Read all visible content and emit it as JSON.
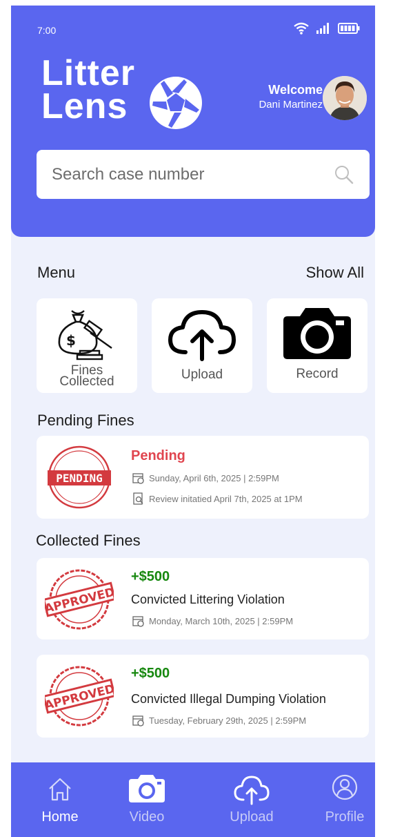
{
  "status_bar": {
    "time": "7:00"
  },
  "brand": {
    "line1": "Litter",
    "line2": "Lens"
  },
  "user": {
    "greeting": "Welcome",
    "name": "Dani Martinez"
  },
  "search": {
    "placeholder": "Search case number"
  },
  "menu": {
    "title": "Menu",
    "show_all": "Show All",
    "items": [
      {
        "label_line1": "Fines",
        "label_line2": "Collected",
        "icon": "money-bag-gavel-icon"
      },
      {
        "label": "Upload",
        "icon": "cloud-upload-icon"
      },
      {
        "label": "Record",
        "icon": "camera-icon"
      }
    ]
  },
  "pending": {
    "title": "Pending Fines",
    "items": [
      {
        "stamp_text": "PENDING",
        "status": "Pending",
        "date": "Sunday, April 6th, 2025 | 2:59PM",
        "review": "Review initatied April 7th, 2025 at 1PM"
      }
    ]
  },
  "collected": {
    "title": "Collected Fines",
    "items": [
      {
        "stamp_text": "APPROVED",
        "amount": "+$500",
        "description": "Convicted Littering Violation",
        "date": "Monday, March 10th, 2025 | 2:59PM"
      },
      {
        "stamp_text": "APPROVED",
        "amount": "+$500",
        "description": "Convicted Illegal Dumping Violation",
        "date": "Tuesday, February 29th, 2025 | 2:59PM"
      }
    ]
  },
  "bottom_nav": [
    {
      "label": "Home",
      "icon": "home-icon",
      "active": true
    },
    {
      "label": "Video",
      "icon": "camera-icon",
      "active": false
    },
    {
      "label": "Upload",
      "icon": "cloud-upload-icon",
      "active": false
    },
    {
      "label": "Profile",
      "icon": "profile-icon",
      "active": false
    }
  ],
  "colors": {
    "primary": "#5a66ef",
    "background": "#eef1fc",
    "pending": "#e0454f",
    "approved": "#17880f",
    "stamp_red": "#d33a3f"
  }
}
